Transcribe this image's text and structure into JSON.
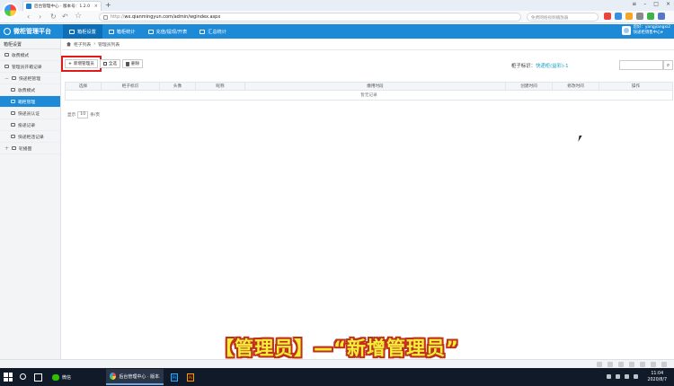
{
  "browser": {
    "tab_title": "后台管理中心 · 版本号：1.2.0",
    "tab_close": "×",
    "new_tab": "+",
    "url_prefix": "http://",
    "url": "wx.qianmingyun.com/admin/wgindex.aspx",
    "search_placeholder": "免费网络视频播放器",
    "win_controls": [
      "≡",
      "–",
      "□",
      "×"
    ],
    "nav": [
      "‹",
      "›",
      "↻",
      "↶",
      "☆"
    ]
  },
  "app": {
    "brand": "微柜管理平台",
    "menu": [
      {
        "label": "箱柜设置",
        "active": true
      },
      {
        "label": "箱柜统计",
        "active": false
      },
      {
        "label": "充值/提现/开表",
        "active": false
      },
      {
        "label": "汇总统计",
        "active": false
      }
    ],
    "user_line1": "您好：yangjiangxi2",
    "user_line2": "快递柜销售中心▾"
  },
  "sidebar": {
    "title": "箱柜设置",
    "items": [
      {
        "label": "收费模式",
        "level": 0,
        "sign": "",
        "active": false
      },
      {
        "label": "管理员开箱记录",
        "level": 0,
        "sign": "",
        "active": false
      },
      {
        "label": "快递柜管理",
        "level": 0,
        "sign": "−",
        "active": false
      },
      {
        "label": "收费模式",
        "level": 1,
        "sign": "",
        "active": false
      },
      {
        "label": "箱柜管理",
        "level": 1,
        "sign": "",
        "active": true
      },
      {
        "label": "快递员认证",
        "level": 1,
        "sign": "",
        "active": false
      },
      {
        "label": "投递记录",
        "level": 1,
        "sign": "",
        "active": false
      },
      {
        "label": "快递柜违记录",
        "level": 1,
        "sign": "",
        "active": false
      },
      {
        "label": "轮播图",
        "level": 0,
        "sign": "+",
        "active": false
      }
    ]
  },
  "main": {
    "breadcrumb": [
      "柜子列表",
      "管理员列表"
    ],
    "breadcrumb_sep": "›",
    "actions": {
      "new_label": "新增管理员",
      "new_icon": "+",
      "select_all_label": "全选",
      "delete_label": "删除"
    },
    "cabinet_label": "柜子标识：",
    "cabinet_value": "快递柜(益彩)-1",
    "table": {
      "headers": [
        "选择",
        "柜子标识",
        "头像",
        "昵称",
        "缴用时段",
        "创建时间",
        "修改时间",
        "操作"
      ],
      "empty_text": "暂无记录"
    },
    "pager": {
      "prefix": "显示",
      "size": "10",
      "suffix": "条/页"
    }
  },
  "caption": "【管理员】—“新增管理员”",
  "taskbar": {
    "apps": [
      {
        "label": "微信",
        "open": false
      },
      {
        "label": "后台管理中心 · 版本...",
        "open": true
      },
      {
        "label": "Ps",
        "open": false
      },
      {
        "label": "Ai",
        "open": false
      }
    ],
    "time": "11:04",
    "date": "2020/8/7"
  },
  "colors": {
    "accent": "#1d8ad8",
    "highlight_box": "#e01919",
    "caption_fill": "#f2ef39",
    "caption_stroke": "#c0301b"
  }
}
